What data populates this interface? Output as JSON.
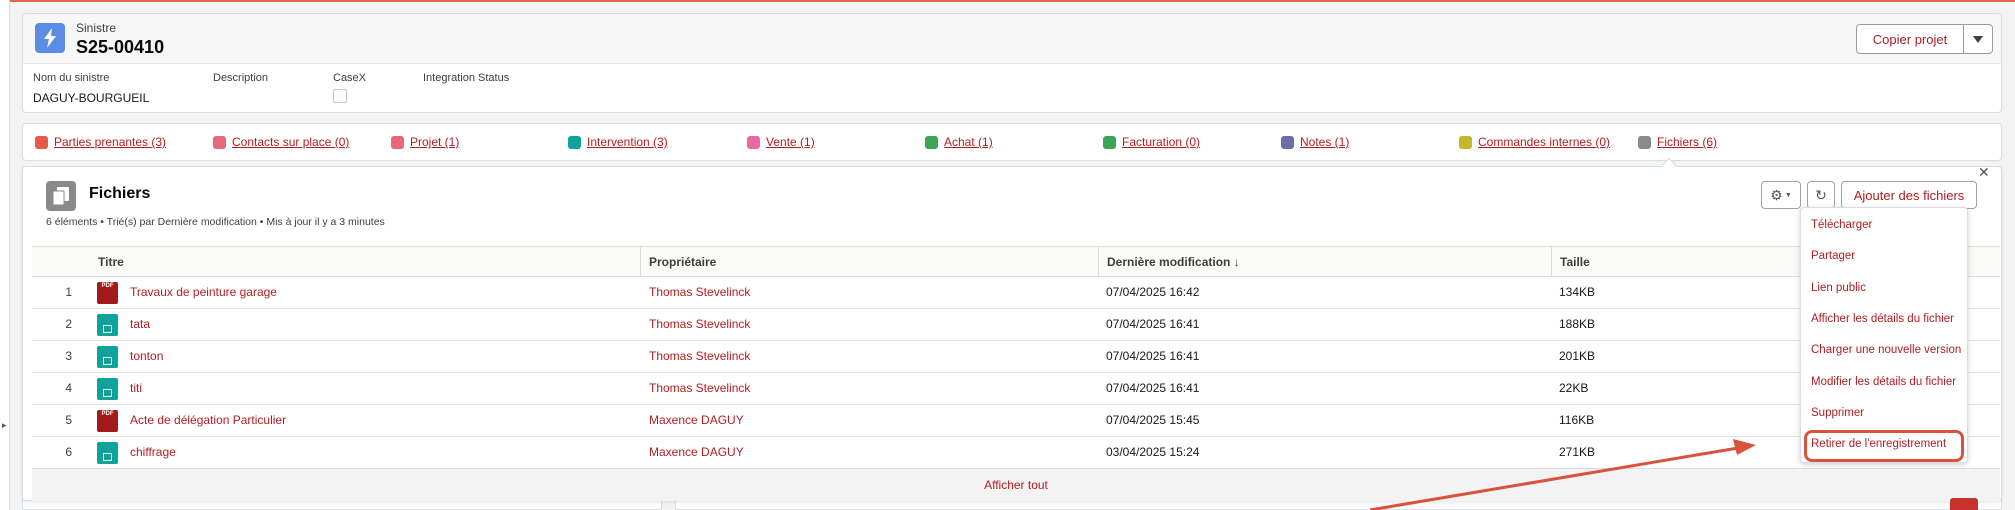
{
  "header": {
    "object_type": "Sinistre",
    "record_name": "S25-00410",
    "copy_button_label": "Copier projet",
    "fields": [
      {
        "label": "Nom du sinistre",
        "value": "DAGUY-BOURGUEIL"
      },
      {
        "label": "Description",
        "value": ""
      },
      {
        "label": "CaseX",
        "value": ""
      },
      {
        "label": "Integration Status",
        "value": ""
      }
    ]
  },
  "tabs": [
    {
      "label": "Parties prenantes (3)",
      "color": "#e8594a"
    },
    {
      "label": "Contacts sur place (0)",
      "color": "#e8677a"
    },
    {
      "label": "Projet (1)",
      "color": "#e8677a"
    },
    {
      "label": "Intervention (3)",
      "color": "#0ea39a"
    },
    {
      "label": "Vente (1)",
      "color": "#e86aa0"
    },
    {
      "label": "Achat (1)",
      "color": "#3ba755"
    },
    {
      "label": "Facturation (0)",
      "color": "#3ba755"
    },
    {
      "label": "Notes (1)",
      "color": "#6a6fa7"
    },
    {
      "label": "Commandes internes (0)",
      "color": "#c5b72b"
    },
    {
      "label": "Fichiers (6)",
      "color": "#8a8a8a"
    }
  ],
  "files_panel": {
    "title": "Fichiers",
    "meta": "6 éléments • Trié(s) par Dernière modification • Mis à jour il y a 3 minutes",
    "add_button_label": "Ajouter des fichiers",
    "show_all_label": "Afficher tout",
    "columns": {
      "title": "Titre",
      "owner": "Propriétaire",
      "modified": "Dernière modification ↓",
      "size": "Taille"
    },
    "rows": [
      {
        "num": "1",
        "type": "pdf",
        "title": "Travaux de peinture garage",
        "owner": "Thomas Stevelinck",
        "modified": "07/04/2025 16:42",
        "size": "134KB"
      },
      {
        "num": "2",
        "type": "img",
        "title": "tata",
        "owner": "Thomas Stevelinck",
        "modified": "07/04/2025 16:41",
        "size": "188KB"
      },
      {
        "num": "3",
        "type": "img",
        "title": "tonton",
        "owner": "Thomas Stevelinck",
        "modified": "07/04/2025 16:41",
        "size": "201KB"
      },
      {
        "num": "4",
        "type": "img",
        "title": "titi",
        "owner": "Thomas Stevelinck",
        "modified": "07/04/2025 16:41",
        "size": "22KB"
      },
      {
        "num": "5",
        "type": "pdf",
        "title": "Acte de délégation Particulier",
        "owner": "Maxence DAGUY",
        "modified": "07/04/2025 15:45",
        "size": "116KB"
      },
      {
        "num": "6",
        "type": "img",
        "title": "chiffrage",
        "owner": "Maxence DAGUY",
        "modified": "03/04/2025 15:24",
        "size": "271KB"
      }
    ],
    "pdf_icon_text": "PDF"
  },
  "dropdown": {
    "items": [
      "Télécharger",
      "Partager",
      "Lien public",
      "Afficher les détails du fichier",
      "Charger une nouvelle version",
      "Modifier les détails du fichier",
      "Supprimer",
      "Retirer de l'enregistrement"
    ],
    "highlight_color": "#d9523b"
  },
  "colors": {
    "link": "#b01e22",
    "object_icon": "#5b8ce6"
  }
}
